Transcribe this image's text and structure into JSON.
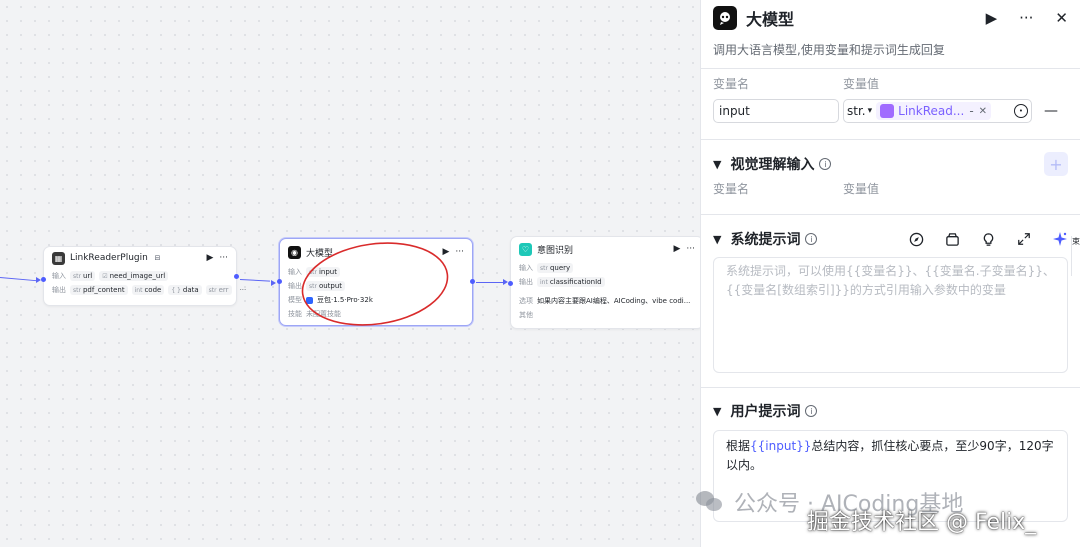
{
  "canvas": {
    "nodes": {
      "link_reader": {
        "title": "LinkReaderPlugin",
        "title_suffix": "⊟",
        "input_label": "输入",
        "inputs": [
          "url",
          "need_image_url"
        ],
        "output_label": "输出",
        "outputs": [
          "pdf_content",
          "code",
          "data",
          "err"
        ]
      },
      "llm": {
        "title": "大模型",
        "input_label": "输入",
        "input": "input",
        "output_label": "输出",
        "output": "output",
        "model_label": "模型",
        "model": "豆包·1.5·Pro·32k",
        "skills_label": "技能",
        "skills": "未配置技能"
      },
      "intent": {
        "title": "意图识别",
        "input_label": "输入",
        "input": "query",
        "output_label": "输出",
        "output": "classificationId",
        "option_label": "选项",
        "option": "如果内容主要跟AI编程、AICoding、vibe codi...",
        "other_label": "其他"
      }
    }
  },
  "panel": {
    "title": "大模型",
    "description": "调用大语言模型,使用变量和提示词生成回复",
    "var_name_header": "变量名",
    "var_value_header": "变量值",
    "input_var_name": "input",
    "input_var_type": "str.",
    "input_var_ref": "LinkRead...",
    "vision_section_title": "视觉理解输入",
    "vision_var_name_header": "变量名",
    "vision_var_value_header": "变量值",
    "system_prompt_title": "系统提示词",
    "system_prompt_placeholder": "系统提示词，可以使用{{变量名}}、{{变量名.子变量名}}、{{变量名[数组索引]}}的方式引用输入参数中的变量",
    "user_prompt_title": "用户提示词",
    "user_prompt_prefix": "根据",
    "user_prompt_var": "{{input}}",
    "user_prompt_suffix": "总结内容，抓住核心要点，至少90字，120字以内。"
  },
  "watermarks": {
    "wechat": "公众号 · AICoding基地",
    "juejin": "掘金技术社区 @ Felix_"
  },
  "colors": {
    "accent": "#4e5dff",
    "annotation": "#d92b2b",
    "plugin_link": "#7b61ff"
  }
}
